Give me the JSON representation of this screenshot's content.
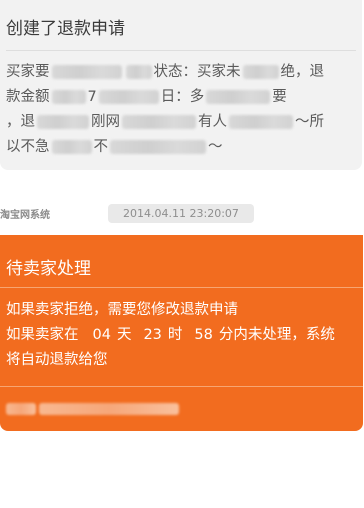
{
  "card1": {
    "title": "创建了退款申请",
    "line1_a": "买家要",
    "line1_b": "状态：买家未",
    "line1_c": "绝，退",
    "line2_a": "款金额",
    "line2_b": "7",
    "line2_c": "日：多",
    "line2_d": "要",
    "line3_a": "，退",
    "line3_b": "刚网",
    "line3_c": "有人",
    "line3_d": "～所",
    "line4_a": "以不急",
    "line4_b": "不",
    "line4_c": "～"
  },
  "meta": {
    "sender": "淘宝网系统",
    "timestamp": "2014.04.11 23:20:07"
  },
  "card2": {
    "title": "待卖家处理",
    "line1": "如果卖家拒绝，需要您修改退款申请",
    "line2_prefix": "如果卖家在",
    "days": "04",
    "days_unit": "天",
    "hours": "23",
    "hours_unit": "时",
    "minutes": "58",
    "line2_suffix": "分内未处理，系统",
    "line3": "将自动退款给您"
  },
  "colors": {
    "accent": "#f26c1f",
    "card_gray": "#f2f2f2"
  }
}
